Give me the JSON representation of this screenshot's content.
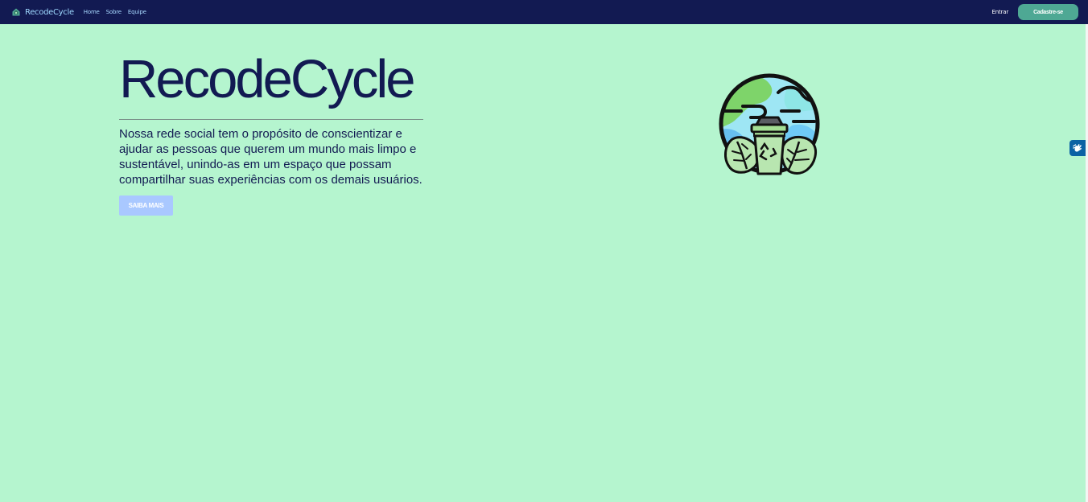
{
  "navbar": {
    "brand_name": "RecodeCycle",
    "links": [
      "Home",
      "Sobre",
      "Equipe"
    ],
    "login_label": "Entrar",
    "signup_label": "Cadastre-se",
    "logo_icon": "recycling-house-icon"
  },
  "hero": {
    "title": "RecodeCycle",
    "description": "Nossa rede social tem o propósito de conscientizar e ajudar as pessoas que querem um mundo mais limpo e sustentável, unindo-as em um espaço que possam compartilhar suas experiências com os demais usuários.",
    "button_label": "SAIBA MAIS"
  },
  "illustration": {
    "icon": "earth-recycling-bin-icon"
  },
  "accessibility": {
    "icon": "sign-language-icon"
  },
  "colors": {
    "background": "#b5f5cf",
    "navbar": "#121a52",
    "brand_accent": "#4ea894",
    "button_primary": "#a9c8ff",
    "title": "#121a52"
  }
}
